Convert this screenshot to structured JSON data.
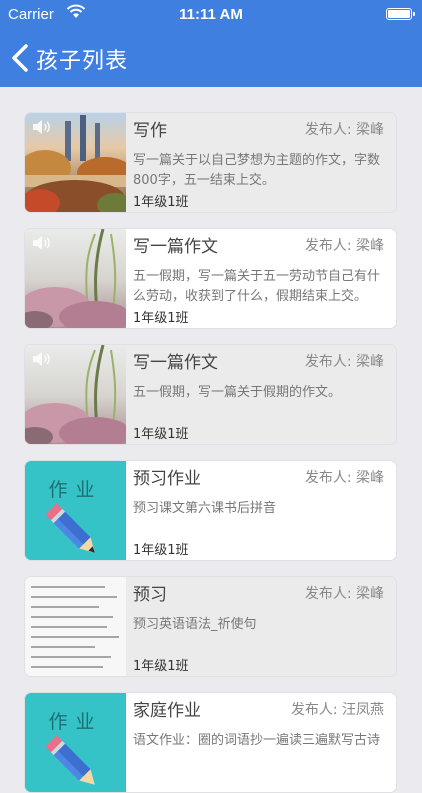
{
  "status": {
    "carrier": "Carrier",
    "time": "11:11 AM"
  },
  "nav": {
    "title": "孩子列表",
    "back_icon": "chevron-left-icon"
  },
  "colors": {
    "bar": "#3f7fe0",
    "card": "#ffffff",
    "card_grey": "#ebebeb",
    "tile": "#35c3c7"
  },
  "publisher_prefix": "发布人:",
  "items": [
    {
      "title": "写作",
      "publisher": "发布人: 梁峰",
      "desc": "写一篇关于以自己梦想为主题的作文，字数800字，五一结束上交。",
      "class": "1年级1班",
      "thumb": "photo-park"
    },
    {
      "title": "写一篇作文",
      "publisher": "发布人: 梁峰",
      "desc": "五一假期，写一篇关于五一劳动节自己有什么劳动，收获到了什么，假期结束上交。",
      "class": "1年级1班",
      "thumb": "photo-blossom"
    },
    {
      "title": "写一篇作文",
      "publisher": "发布人: 梁峰",
      "desc": "五一假期，写一篇关于假期的作文。",
      "class": "1年级1班",
      "thumb": "photo-blossom"
    },
    {
      "title": "预习作业",
      "publisher": "发布人: 梁峰",
      "desc": "预习课文第六课书后拼音",
      "class": "1年级1班",
      "thumb": "homework-tile",
      "tile_text": "作业"
    },
    {
      "title": "预习",
      "publisher": "发布人: 梁峰",
      "desc": "预习英语语法_祈使句",
      "class": "1年级1班",
      "thumb": "document-scan"
    },
    {
      "title": "家庭作业",
      "publisher": "发布人: 汪凤燕",
      "desc": "语文作业：圈的词语抄一遍读三遍默写古诗",
      "class": "",
      "thumb": "homework-tile",
      "tile_text": "作业"
    }
  ]
}
